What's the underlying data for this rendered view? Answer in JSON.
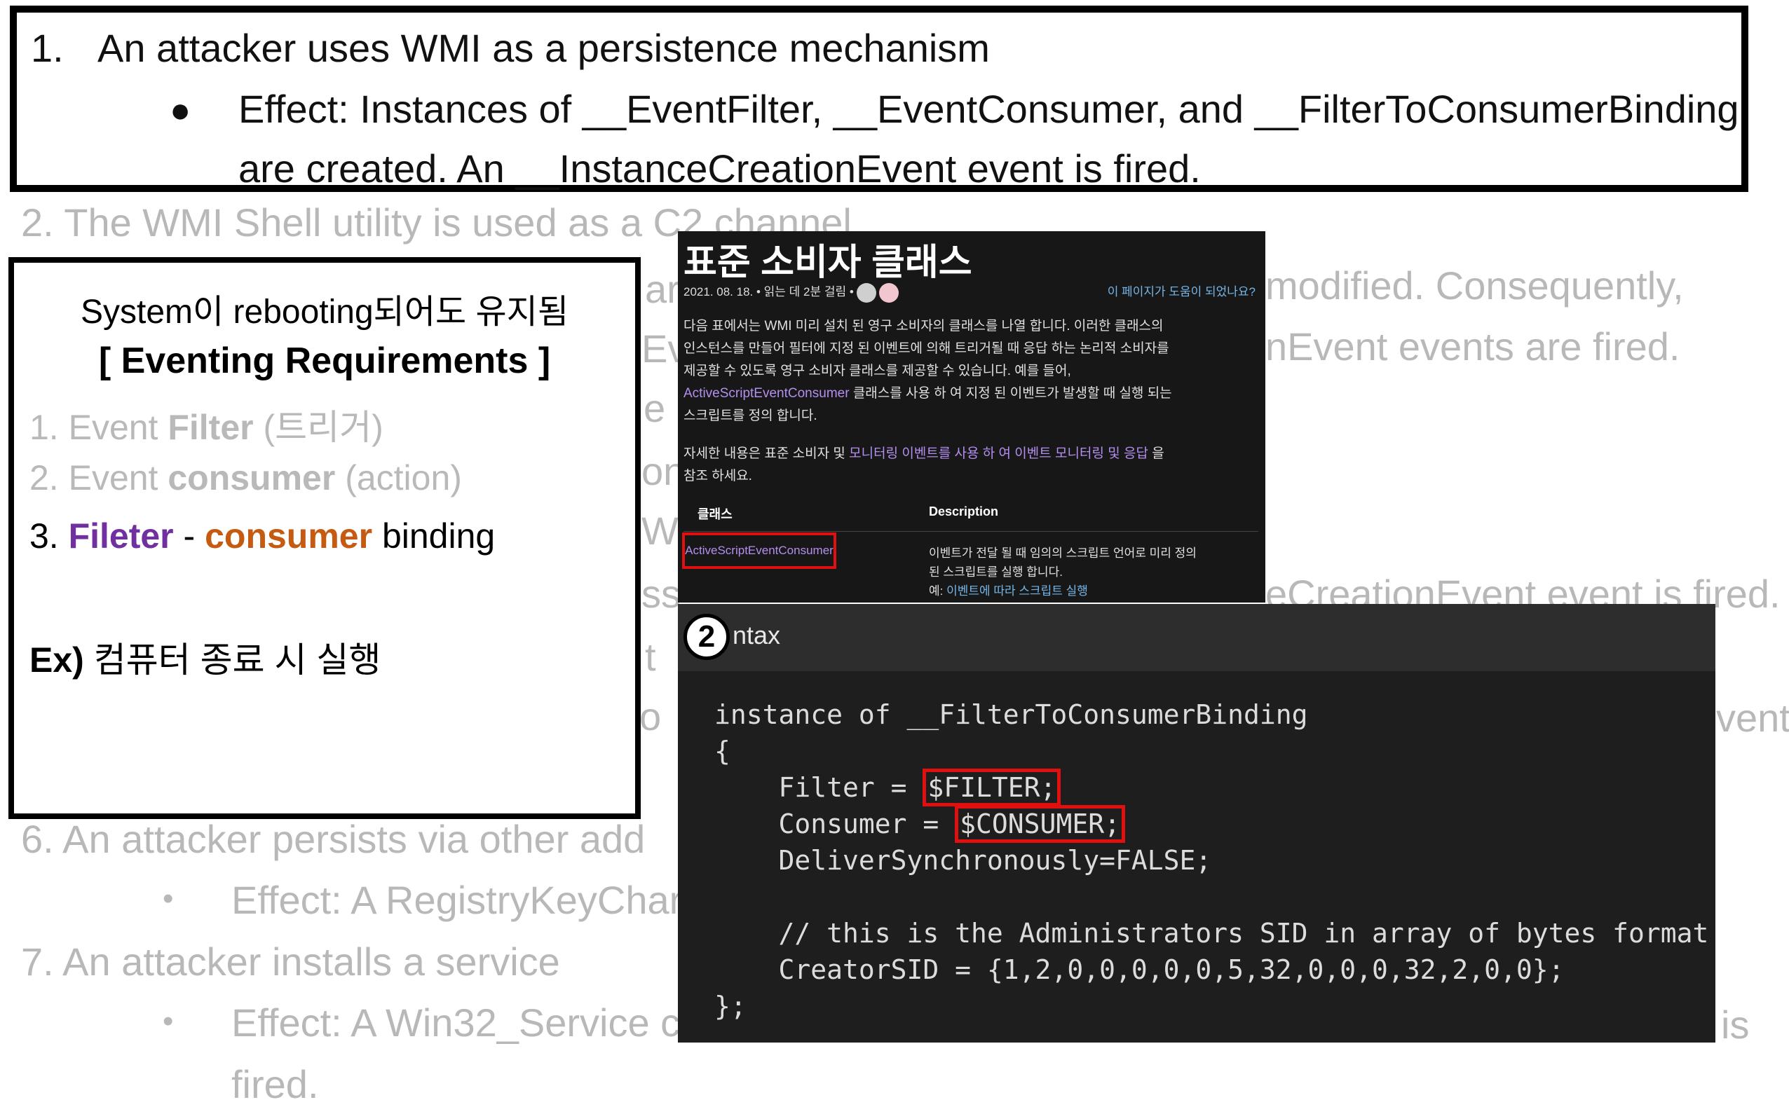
{
  "top_box": {
    "item1_number": "1.",
    "item1_text": "An attacker uses WMI as a persistence mechanism",
    "effect_line1": "Effect: Instances of __EventFilter, __EventConsumer, and __FilterToConsumerBinding",
    "effect_line2": "are created. An __InstanceCreationEvent event is fired."
  },
  "background": {
    "item2": "2.    The WMI Shell utility is used as a C2 channel",
    "frag_modified": "modified. Consequently,",
    "frag_events": "nEvent events are fired.",
    "frag_creation": "eCreationEvent event is fired.",
    "frag_vent": "vent",
    "frag_is": "is",
    "item6": "6.    An attacker persists via other add",
    "item6_effect": "Effect: A RegistryKeyChar",
    "item7": "7.    An attacker installs a service",
    "item7_effect": "Effect: A Win32_Service c",
    "item7_fired": "fired.",
    "mid_a": "ar",
    "mid_b": "Ev",
    "mid_c": "e",
    "mid_d": "on",
    "mid_e": "W",
    "mid_f": "ss",
    "mid_g": "t",
    "mid_h": "o"
  },
  "note_box": {
    "line1": "System이 rebooting되어도 유지됨",
    "line2": "[ Eventing Requirements ]",
    "item1_prefix": "1. Event ",
    "item1_bold": "Filter",
    "item1_suffix": " (트리거)",
    "item2_prefix": "2. Event ",
    "item2_bold": "consumer",
    "item2_suffix": " (action)",
    "item3_prefix": "3. ",
    "item3_filter": "Fileter",
    "item3_dash": " - ",
    "item3_consumer": "consumer",
    "item3_suffix": " binding",
    "example_bold": "Ex)",
    "example_text": " 컴퓨터 종료 시 실행"
  },
  "docs": {
    "title": "표준 소비자 클래스",
    "meta": "2021. 08. 18. • 읽는 데 2분 걸림 •",
    "helpful": "이 페이지가 도움이 되었나요?",
    "para1_l1": "다음 표에서는 WMI 미리 설치 된 영구 소비자의 클래스를 나열 합니다. 이러한 클래스의",
    "para1_l2": "인스턴스를 만들어 필터에 지정 된 이벤트에 의해 트리거될 때 응답 하는 논리적 소비자를",
    "para1_l3": "제공할 수 있도록 영구 소비자 클래스를 제공할 수 있습니다. 예를 들어,",
    "para1_link": "ActiveScriptEventConsumer",
    "para1_l4": " 클래스를 사용 하 여 지정 된 이벤트가 발생할 때 실행 되는",
    "para1_l5": "스크립트를 정의 합니다.",
    "para2_a": "자세한 내용은 표준 소비자 및 ",
    "para2_link": "모니터링 이벤트를 사용 하 여 이벤트 모니터링 및 응답",
    "para2_b": " 을",
    "para2_c": "참조 하세요.",
    "col_class": "클래스",
    "col_desc": "Description",
    "row_class": "ActiveScriptEventConsumer",
    "row_desc1": "이벤트가 전달 될 때 임의의 스크립트 언어로 미리 정의",
    "row_desc2": "된 스크립트를 실행 합니다.",
    "row_desc3_label": "예: ",
    "row_desc3_link": "이벤트에 따라 스크립트 실행"
  },
  "code": {
    "badge": "2",
    "header": "ntax",
    "line1": "instance of __FilterToConsumerBinding",
    "line2": "{",
    "line3_a": "    Filter = ",
    "line3_hl": "$FILTER;",
    "line4_a": "    Consumer = ",
    "line4_hl": "$CONSUMER;",
    "line5": "    DeliverSynchronously=FALSE;",
    "line6": "",
    "line7": "    // this is the Administrators SID in array of bytes format",
    "line8": "    CreatorSID = {1,2,0,0,0,0,0,5,32,0,0,0,32,2,0,0};",
    "line9": "};"
  }
}
